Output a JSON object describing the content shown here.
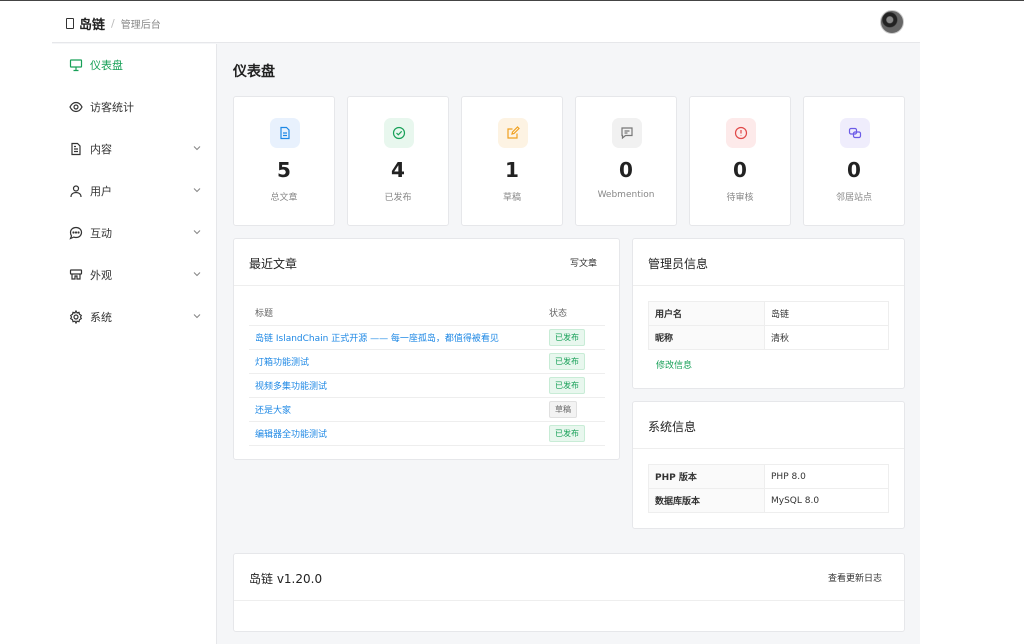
{
  "header": {
    "brand_name": "岛链",
    "separator": "/",
    "subtitle": "管理后台"
  },
  "sidebar": {
    "items": [
      {
        "label": "仪表盘",
        "icon": "presentation-icon"
      },
      {
        "label": "访客统计",
        "icon": "eye-icon"
      },
      {
        "label": "内容",
        "icon": "document-icon"
      },
      {
        "label": "用户",
        "icon": "user-icon"
      },
      {
        "label": "互动",
        "icon": "chat-icon"
      },
      {
        "label": "外观",
        "icon": "palette-icon"
      },
      {
        "label": "系统",
        "icon": "gear-icon"
      }
    ]
  },
  "page": {
    "title": "仪表盘"
  },
  "stats": [
    {
      "value": "5",
      "label": "总文章",
      "color": "#1e88e5",
      "bg": "#e8f1fd"
    },
    {
      "value": "4",
      "label": "已发布",
      "color": "#18a058",
      "bg": "#e8f7ee"
    },
    {
      "value": "1",
      "label": "草稿",
      "color": "#f0a020",
      "bg": "#fdf3e3"
    },
    {
      "value": "0",
      "label": "Webmention",
      "color": "#777777",
      "bg": "#f1f1f1"
    },
    {
      "value": "0",
      "label": "待审核",
      "color": "#e04848",
      "bg": "#fdeaea"
    },
    {
      "value": "0",
      "label": "邻居站点",
      "color": "#6c5ce7",
      "bg": "#efedfc"
    }
  ],
  "recent_posts": {
    "title": "最近文章",
    "action": "写文章",
    "col_title": "标题",
    "col_status": "状态",
    "rows": [
      {
        "title": "岛链 IslandChain 正式开源 —— 每一座孤岛，都值得被看见",
        "status": "已发布"
      },
      {
        "title": "灯箱功能测试",
        "status": "已发布"
      },
      {
        "title": "视频多集功能测试",
        "status": "已发布"
      },
      {
        "title": "还是大家",
        "status": "草稿"
      },
      {
        "title": "编辑器全功能测试",
        "status": "已发布"
      }
    ]
  },
  "admin_info": {
    "title": "管理员信息",
    "rows": [
      {
        "key": "用户名",
        "value": "岛链"
      },
      {
        "key": "昵称",
        "value": "清秋"
      }
    ],
    "edit_label": "修改信息"
  },
  "system_info": {
    "title": "系统信息",
    "rows": [
      {
        "key": "PHP 版本",
        "value": "PHP 8.0"
      },
      {
        "key": "数据库版本",
        "value": "MySQL 8.0"
      }
    ]
  },
  "version_panel": {
    "title": "岛链 v1.20.0",
    "action": "查看更新日志"
  }
}
